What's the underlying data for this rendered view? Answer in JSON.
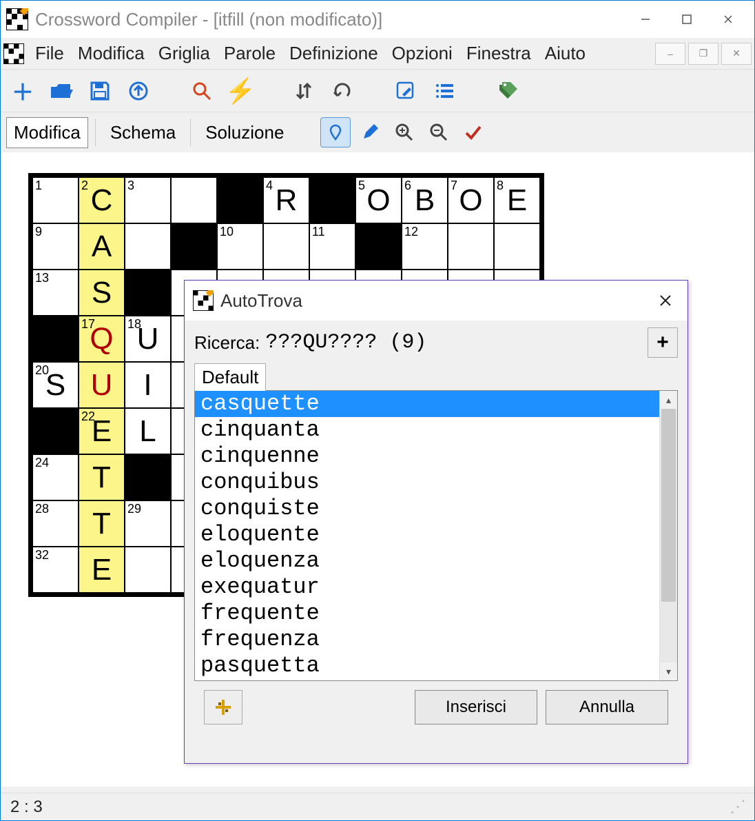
{
  "titlebar": {
    "title": "Crossword Compiler - [itfill (non modificato)]"
  },
  "menubar": {
    "items": [
      "File",
      "Modifica",
      "Griglia",
      "Parole",
      "Definizione",
      "Opzioni",
      "Finestra",
      "Aiuto"
    ]
  },
  "viewbar": {
    "tabs": [
      "Modifica",
      "Schema",
      "Soluzione"
    ]
  },
  "statusbar": {
    "position": "2 : 3"
  },
  "dialog": {
    "title": "AutoTrova",
    "search_label": "Ricerca:",
    "search_value": "???QU????  (9)",
    "tab_label": "Default",
    "results": [
      "casquette",
      "cinquanta",
      "cinquenne",
      "conquibus",
      "conquiste",
      "eloquente",
      "eloquenza",
      "exequatur",
      "frequente",
      "frequenza",
      "pasquetta"
    ],
    "selected_index": 0,
    "insert_label": "Inserisci",
    "cancel_label": "Annulla"
  },
  "grid": {
    "cols": 11,
    "rows": 9,
    "highlight_col": 1,
    "highlight_letters": [
      "C",
      "A",
      "S",
      "Q",
      "U",
      "E",
      "T",
      "T",
      "E"
    ],
    "cells": [
      [
        {
          "n": "1"
        },
        {
          "n": "2",
          "hl": true,
          "l": "C"
        },
        {
          "n": "3"
        },
        {},
        {
          "b": true
        },
        {
          "n": "4",
          "l": "R"
        },
        {
          "b": true
        },
        {
          "n": "5",
          "l": "O"
        },
        {
          "n": "6",
          "l": "B"
        },
        {
          "n": "7",
          "l": "O"
        },
        {
          "n": "8",
          "l": "E"
        }
      ],
      [
        {
          "n": "9"
        },
        {
          "hl": true,
          "l": "A"
        },
        {},
        {
          "b": true
        },
        {
          "n": "10"
        },
        {},
        {
          "n": "11"
        },
        {
          "b": true
        },
        {
          "n": "12"
        },
        {},
        {}
      ],
      [
        {
          "n": "13"
        },
        {
          "hl": true,
          "l": "S"
        },
        {
          "b": true
        },
        {},
        {},
        {},
        {},
        {},
        {},
        {},
        {}
      ],
      [
        {
          "b": true
        },
        {
          "n": "17",
          "hl": true,
          "l": "Q",
          "red": true
        },
        {
          "n": "18",
          "l": "U"
        },
        {},
        {},
        {},
        {},
        {},
        {},
        {},
        {}
      ],
      [
        {
          "n": "20",
          "l": "S"
        },
        {
          "hl": true,
          "l": "U",
          "red": true
        },
        {
          "l": "I"
        },
        {},
        {},
        {},
        {},
        {},
        {},
        {},
        {}
      ],
      [
        {
          "b": true
        },
        {
          "n": "22",
          "hl": true,
          "l": "E"
        },
        {
          "l": "L"
        },
        {},
        {},
        {},
        {},
        {},
        {},
        {},
        {}
      ],
      [
        {
          "n": "24"
        },
        {
          "hl": true,
          "l": "T"
        },
        {
          "b": true
        },
        {},
        {},
        {},
        {},
        {},
        {},
        {},
        {}
      ],
      [
        {
          "n": "28"
        },
        {
          "hl": true,
          "l": "T"
        },
        {
          "n": "29"
        },
        {},
        {},
        {},
        {},
        {},
        {},
        {},
        {}
      ],
      [
        {
          "n": "32"
        },
        {
          "hl": true,
          "l": "E"
        },
        {},
        {},
        {},
        {},
        {},
        {},
        {},
        {},
        {}
      ]
    ]
  }
}
